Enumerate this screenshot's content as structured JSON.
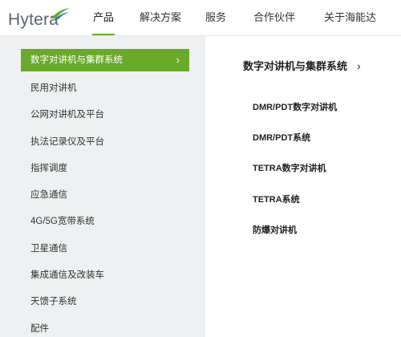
{
  "brand": {
    "name": "Hytera",
    "accent": "#6aaa2a",
    "sidebar_bg": "#eef0f1"
  },
  "nav": {
    "items": [
      {
        "label": "产品"
      },
      {
        "label": "解决方案"
      },
      {
        "label": "服务"
      },
      {
        "label": "合作伙伴"
      },
      {
        "label": "关于海能达"
      }
    ],
    "active": "产品"
  },
  "sidebar": {
    "items": [
      {
        "label": "数字对讲机与集群系统"
      },
      {
        "label": "民用对讲机"
      },
      {
        "label": "公网对讲机及平台"
      },
      {
        "label": "执法记录仪及平台"
      },
      {
        "label": "指挥调度"
      },
      {
        "label": "应急通信"
      },
      {
        "label": "4G/5G宽带系统"
      },
      {
        "label": "卫星通信"
      },
      {
        "label": "集成通信及改装车"
      },
      {
        "label": "天馈子系统"
      },
      {
        "label": "配件"
      }
    ],
    "chevron": "›"
  },
  "main": {
    "title": "数字对讲机与集群系统",
    "chevron": "›",
    "items": [
      {
        "label": "DMR/PDT数字对讲机"
      },
      {
        "label": "DMR/PDT系统"
      },
      {
        "label": "TETRA数字对讲机"
      },
      {
        "label": "TETRA系统"
      },
      {
        "label": "防爆对讲机"
      }
    ]
  }
}
